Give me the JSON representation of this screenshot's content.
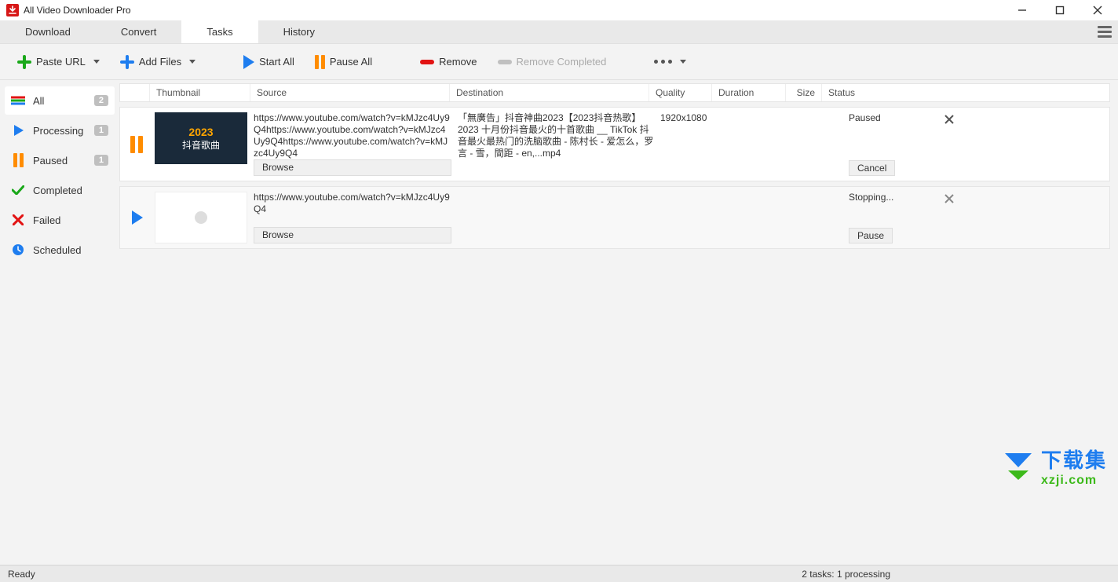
{
  "window": {
    "title": "All Video Downloader Pro"
  },
  "tabs": {
    "download": "Download",
    "convert": "Convert",
    "tasks": "Tasks",
    "history": "History"
  },
  "toolbar": {
    "paste_url": "Paste URL",
    "add_files": "Add Files",
    "start_all": "Start All",
    "pause_all": "Pause All",
    "remove": "Remove",
    "remove_completed": "Remove Completed"
  },
  "sidebar": {
    "all": {
      "label": "All",
      "count": "2"
    },
    "processing": {
      "label": "Processing",
      "count": "1"
    },
    "paused": {
      "label": "Paused",
      "count": "1"
    },
    "completed": {
      "label": "Completed"
    },
    "failed": {
      "label": "Failed"
    },
    "scheduled": {
      "label": "Scheduled"
    }
  },
  "columns": {
    "thumbnail": "Thumbnail",
    "source": "Source",
    "destination": "Destination",
    "quality": "Quality",
    "duration": "Duration",
    "size": "Size",
    "status": "Status"
  },
  "tasks": [
    {
      "source": "https://www.youtube.com/watch?v=kMJzc4Uy9Q4https://www.youtube.com/watch?v=kMJzc4Uy9Q4https://www.youtube.com/watch?v=kMJzc4Uy9Q4",
      "browse": "Browse",
      "destination": "「無廣告」抖音神曲2023【2023抖音热歌】2023 十月份抖音最火的十首歌曲 __ TikTok 抖音最火最热门的洗脑歌曲 - 陈村长 - 爱怎么，罗言 - 雪，間距 - en,...mp4",
      "quality": "1920x1080",
      "duration": "",
      "size": "",
      "status": "Paused",
      "action": "Cancel",
      "thumbnail_year": "2023",
      "thumbnail_text": "抖音歌曲"
    },
    {
      "source": "https://www.youtube.com/watch?v=kMJzc4Uy9Q4",
      "browse": "Browse",
      "destination": "",
      "quality": "",
      "duration": "",
      "size": "",
      "status": "Stopping...",
      "action": "Pause"
    }
  ],
  "statusbar": {
    "left": "Ready",
    "right": "2 tasks: 1 processing"
  },
  "watermark": {
    "line1": "下载集",
    "line2": "xzji.com"
  }
}
